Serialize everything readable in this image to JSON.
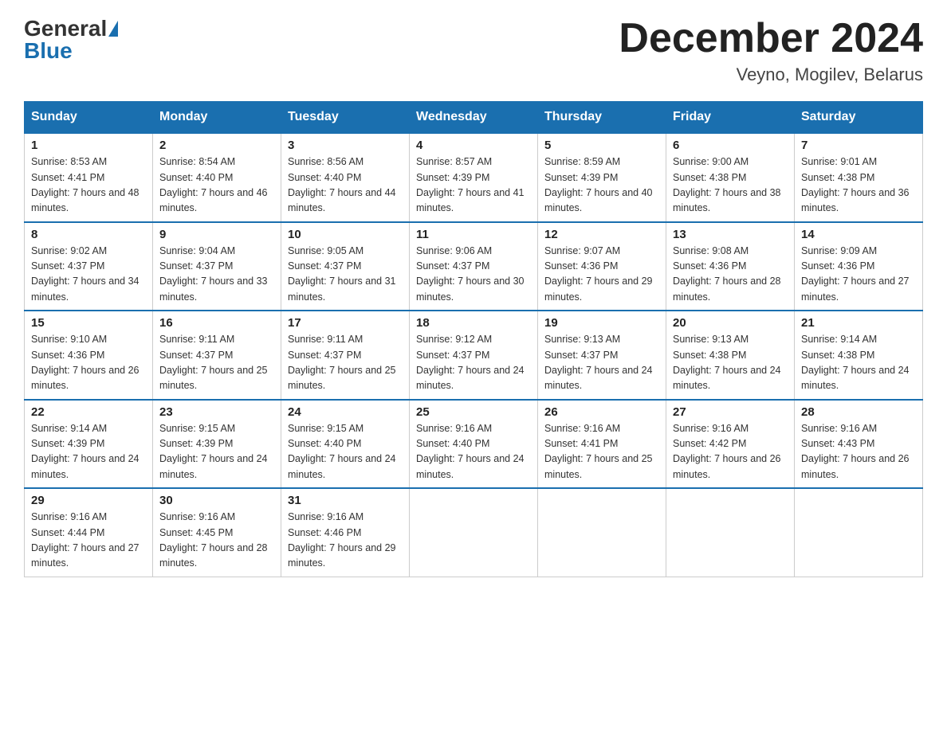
{
  "header": {
    "logo_general": "General",
    "logo_blue": "Blue",
    "title": "December 2024",
    "location": "Veyno, Mogilev, Belarus"
  },
  "days_of_week": [
    "Sunday",
    "Monday",
    "Tuesday",
    "Wednesday",
    "Thursday",
    "Friday",
    "Saturday"
  ],
  "weeks": [
    [
      {
        "day": "1",
        "sunrise": "8:53 AM",
        "sunset": "4:41 PM",
        "daylight": "7 hours and 48 minutes."
      },
      {
        "day": "2",
        "sunrise": "8:54 AM",
        "sunset": "4:40 PM",
        "daylight": "7 hours and 46 minutes."
      },
      {
        "day": "3",
        "sunrise": "8:56 AM",
        "sunset": "4:40 PM",
        "daylight": "7 hours and 44 minutes."
      },
      {
        "day": "4",
        "sunrise": "8:57 AM",
        "sunset": "4:39 PM",
        "daylight": "7 hours and 41 minutes."
      },
      {
        "day": "5",
        "sunrise": "8:59 AM",
        "sunset": "4:39 PM",
        "daylight": "7 hours and 40 minutes."
      },
      {
        "day": "6",
        "sunrise": "9:00 AM",
        "sunset": "4:38 PM",
        "daylight": "7 hours and 38 minutes."
      },
      {
        "day": "7",
        "sunrise": "9:01 AM",
        "sunset": "4:38 PM",
        "daylight": "7 hours and 36 minutes."
      }
    ],
    [
      {
        "day": "8",
        "sunrise": "9:02 AM",
        "sunset": "4:37 PM",
        "daylight": "7 hours and 34 minutes."
      },
      {
        "day": "9",
        "sunrise": "9:04 AM",
        "sunset": "4:37 PM",
        "daylight": "7 hours and 33 minutes."
      },
      {
        "day": "10",
        "sunrise": "9:05 AM",
        "sunset": "4:37 PM",
        "daylight": "7 hours and 31 minutes."
      },
      {
        "day": "11",
        "sunrise": "9:06 AM",
        "sunset": "4:37 PM",
        "daylight": "7 hours and 30 minutes."
      },
      {
        "day": "12",
        "sunrise": "9:07 AM",
        "sunset": "4:36 PM",
        "daylight": "7 hours and 29 minutes."
      },
      {
        "day": "13",
        "sunrise": "9:08 AM",
        "sunset": "4:36 PM",
        "daylight": "7 hours and 28 minutes."
      },
      {
        "day": "14",
        "sunrise": "9:09 AM",
        "sunset": "4:36 PM",
        "daylight": "7 hours and 27 minutes."
      }
    ],
    [
      {
        "day": "15",
        "sunrise": "9:10 AM",
        "sunset": "4:36 PM",
        "daylight": "7 hours and 26 minutes."
      },
      {
        "day": "16",
        "sunrise": "9:11 AM",
        "sunset": "4:37 PM",
        "daylight": "7 hours and 25 minutes."
      },
      {
        "day": "17",
        "sunrise": "9:11 AM",
        "sunset": "4:37 PM",
        "daylight": "7 hours and 25 minutes."
      },
      {
        "day": "18",
        "sunrise": "9:12 AM",
        "sunset": "4:37 PM",
        "daylight": "7 hours and 24 minutes."
      },
      {
        "day": "19",
        "sunrise": "9:13 AM",
        "sunset": "4:37 PM",
        "daylight": "7 hours and 24 minutes."
      },
      {
        "day": "20",
        "sunrise": "9:13 AM",
        "sunset": "4:38 PM",
        "daylight": "7 hours and 24 minutes."
      },
      {
        "day": "21",
        "sunrise": "9:14 AM",
        "sunset": "4:38 PM",
        "daylight": "7 hours and 24 minutes."
      }
    ],
    [
      {
        "day": "22",
        "sunrise": "9:14 AM",
        "sunset": "4:39 PM",
        "daylight": "7 hours and 24 minutes."
      },
      {
        "day": "23",
        "sunrise": "9:15 AM",
        "sunset": "4:39 PM",
        "daylight": "7 hours and 24 minutes."
      },
      {
        "day": "24",
        "sunrise": "9:15 AM",
        "sunset": "4:40 PM",
        "daylight": "7 hours and 24 minutes."
      },
      {
        "day": "25",
        "sunrise": "9:16 AM",
        "sunset": "4:40 PM",
        "daylight": "7 hours and 24 minutes."
      },
      {
        "day": "26",
        "sunrise": "9:16 AM",
        "sunset": "4:41 PM",
        "daylight": "7 hours and 25 minutes."
      },
      {
        "day": "27",
        "sunrise": "9:16 AM",
        "sunset": "4:42 PM",
        "daylight": "7 hours and 26 minutes."
      },
      {
        "day": "28",
        "sunrise": "9:16 AM",
        "sunset": "4:43 PM",
        "daylight": "7 hours and 26 minutes."
      }
    ],
    [
      {
        "day": "29",
        "sunrise": "9:16 AM",
        "sunset": "4:44 PM",
        "daylight": "7 hours and 27 minutes."
      },
      {
        "day": "30",
        "sunrise": "9:16 AM",
        "sunset": "4:45 PM",
        "daylight": "7 hours and 28 minutes."
      },
      {
        "day": "31",
        "sunrise": "9:16 AM",
        "sunset": "4:46 PM",
        "daylight": "7 hours and 29 minutes."
      },
      null,
      null,
      null,
      null
    ]
  ]
}
